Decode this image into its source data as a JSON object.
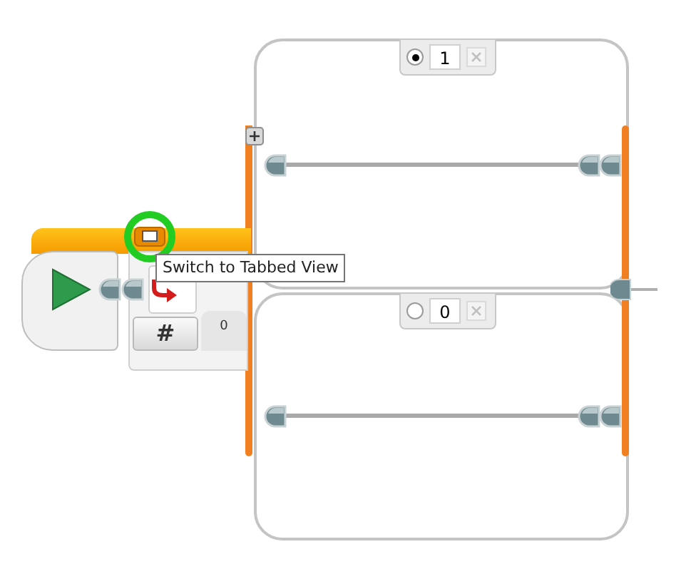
{
  "switch_block": {
    "tooltip": "Switch to Tabbed View",
    "mode_label": "#",
    "input_value": "0",
    "cases": [
      {
        "label": "1",
        "selected": true
      },
      {
        "label": "0",
        "selected": false
      }
    ]
  }
}
